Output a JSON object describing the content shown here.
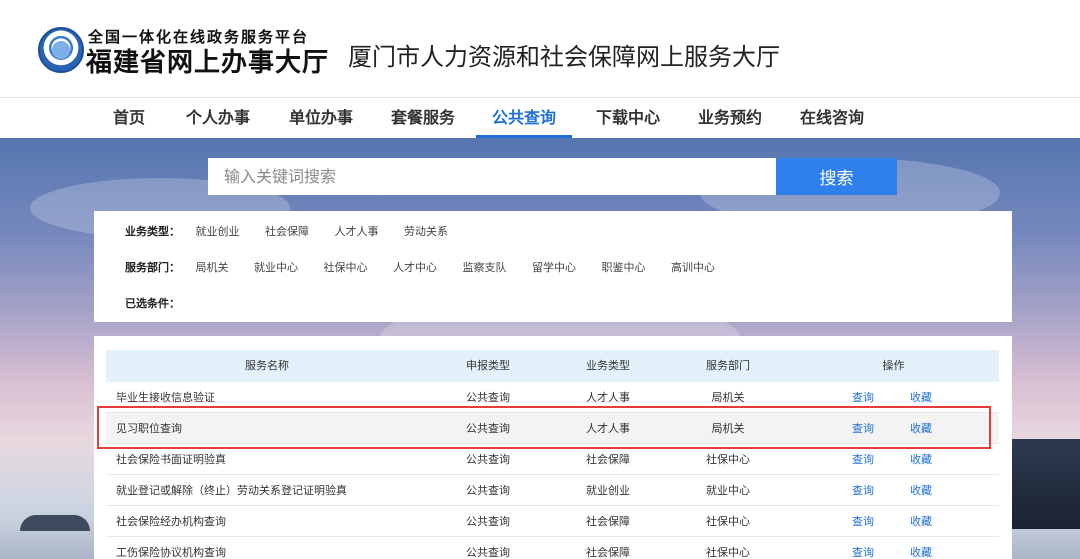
{
  "header": {
    "platform_top": "全国一体化在线政务服务平台",
    "platform_main": "福建省网上办事大厅",
    "site_title": "厦门市人力资源和社会保障网上服务大厅"
  },
  "nav": {
    "items": [
      "首页",
      "个人办事",
      "单位办事",
      "套餐服务",
      "公共查询",
      "下载中心",
      "业务预约",
      "在线咨询"
    ],
    "active": "公共查询"
  },
  "search": {
    "placeholder": "输入关键词搜索",
    "button_label": "搜索"
  },
  "filters": {
    "business_type": {
      "label": "业务类型：",
      "options": [
        "就业创业",
        "社会保障",
        "人才人事",
        "劳动关系"
      ]
    },
    "department": {
      "label": "服务部门：",
      "options": [
        "局机关",
        "就业中心",
        "社保中心",
        "人才中心",
        "监察支队",
        "留学中心",
        "职鉴中心",
        "高训中心"
      ]
    },
    "selected": {
      "label": "已选条件："
    }
  },
  "table": {
    "columns": [
      "服务名称",
      "申报类型",
      "业务类型",
      "服务部门",
      "操作"
    ],
    "query_label": "查询",
    "favorite_label": "收藏",
    "rows": [
      {
        "name": "毕业生接收信息验证",
        "declare_type": "公共查询",
        "business_type": "人才人事",
        "department": "局机关"
      },
      {
        "name": "见习职位查询",
        "declare_type": "公共查询",
        "business_type": "人才人事",
        "department": "局机关"
      },
      {
        "name": "社会保险书面证明验真",
        "declare_type": "公共查询",
        "business_type": "社会保障",
        "department": "社保中心"
      },
      {
        "name": "就业登记或解除（终止）劳动关系登记证明验真",
        "declare_type": "公共查询",
        "business_type": "就业创业",
        "department": "就业中心"
      },
      {
        "name": "社会保险经办机构查询",
        "declare_type": "公共查询",
        "business_type": "社会保障",
        "department": "社保中心"
      },
      {
        "name": "工伤保险协议机构查询",
        "declare_type": "公共查询",
        "business_type": "社会保障",
        "department": "社保中心"
      }
    ]
  }
}
